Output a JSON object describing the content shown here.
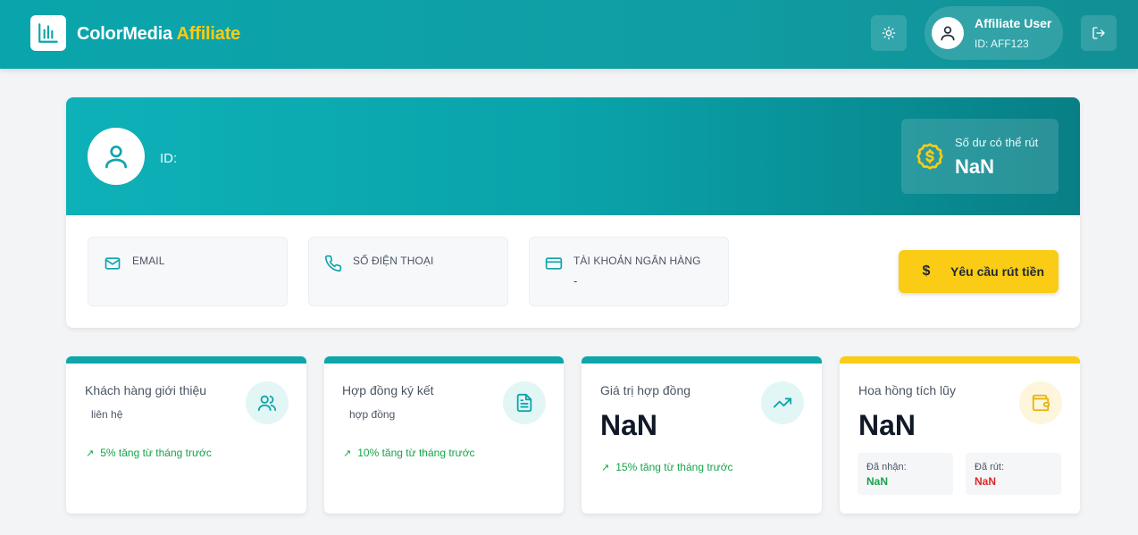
{
  "header": {
    "brand_main": "ColorMedia",
    "brand_accent": "Affiliate",
    "user": {
      "name": "Affiliate User",
      "id": "ID: AFF123"
    },
    "icons": {
      "logo": "bar-chart-icon",
      "theme": "sun-icon",
      "user": "user-icon",
      "logout": "logout-icon"
    }
  },
  "profile": {
    "id_label": "ID:",
    "balance": {
      "label": "Số dư có thể rút",
      "value": "NaN"
    },
    "info": [
      {
        "label": "EMAIL",
        "value": "",
        "icon": "mail-icon"
      },
      {
        "label": "SỐ ĐIỆN THOẠI",
        "value": "",
        "icon": "phone-icon"
      },
      {
        "label": "TÀI KHOẢN NGÂN HÀNG",
        "value": "-",
        "icon": "credit-card-icon"
      }
    ],
    "withdraw_button": {
      "symbol": "$",
      "label": "Yêu cầu rút tiền"
    }
  },
  "stats": [
    {
      "title": "Khách hàng giới thiệu",
      "sub": "liên hệ",
      "trend": "5% tăng từ tháng trước",
      "icon": "users-icon"
    },
    {
      "title": "Hợp đồng ký kết",
      "sub": "hợp đồng",
      "trend": "10% tăng từ tháng trước",
      "icon": "document-icon"
    },
    {
      "title": "Giá trị hợp đồng",
      "value": "NaN",
      "trend": "15% tăng từ tháng trước",
      "icon": "trending-up-icon"
    },
    {
      "title": "Hoa hồng tích lũy",
      "value": "NaN",
      "icon": "wallet-icon",
      "received": {
        "label": "Đã nhận:",
        "value": "NaN"
      },
      "withdrawn": {
        "label": "Đã rút:",
        "value": "NaN"
      }
    }
  ],
  "colors": {
    "teal": "#0ea5ab",
    "accent_yellow": "#facc15",
    "positive": "#16a34a",
    "negative": "#dc2626"
  }
}
